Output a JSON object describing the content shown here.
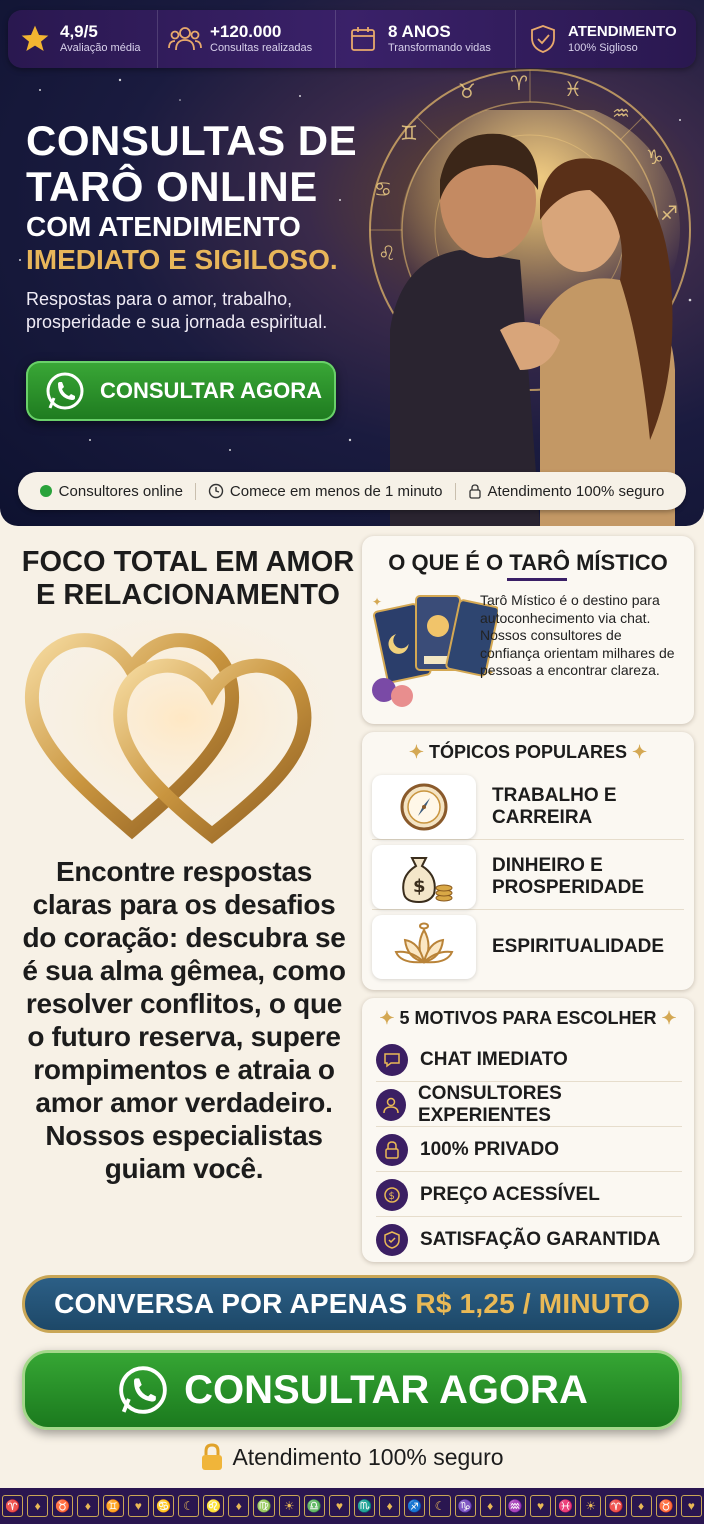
{
  "stats": [
    {
      "value": "4,9/5",
      "label": "Avaliação média",
      "icon": "star-icon"
    },
    {
      "value": "+120.000",
      "label": "Consultas realizadas",
      "icon": "people-icon"
    },
    {
      "value": "8 ANOS",
      "label": "Transformando vidas",
      "icon": "calendar-icon"
    },
    {
      "value": "ATENDIMENTO",
      "label": "100% Siglioso",
      "icon": "shield-icon"
    }
  ],
  "hero": {
    "title_line1": "CONSULTAS DE",
    "title_line2": "TARÔ ONLINE",
    "subtitle_line1": "COM ATENDIMENTO",
    "subtitle_line2": "IMEDIATO E SIGILOSO.",
    "description": "Respostas para o amor, trabalho, prosperidade e sua jornada espiritual.",
    "cta": "CONSULTAR AGORA"
  },
  "trust_pill": [
    {
      "label": "Consultores online",
      "icon": "online-dot-icon"
    },
    {
      "label": "Comece em menos de 1 minuto",
      "icon": "clock-icon"
    },
    {
      "label": "Atendimento 100% seguro",
      "icon": "lock-icon"
    }
  ],
  "love": {
    "title": "FOCO TOTAL EM AMOR E RELACIONAMENTO",
    "text": "Encontre respostas claras para os desafios do coração: descubra se é sua alma gêmea, como resolver conflitos, o que o futuro reserva, supere rompimentos e atraia o amor amor verdadeiro. Nossos especialistas guiam você."
  },
  "about": {
    "title": "O QUE É O TARÔ MÍSTICO",
    "text": "Tarô Místico é o destino para autoconhecimento via chat. Nossos consultores de confiança orientam milhares de pessoas a encontrar clareza."
  },
  "topics": {
    "title": "TÓPICOS POPULARES",
    "items": [
      {
        "label": "TRABALHO E CARREIRA",
        "icon": "compass-icon"
      },
      {
        "label": "DINHEIRO E PROSPERIDADE",
        "icon": "money-bag-icon"
      },
      {
        "label": "ESPIRITUALIDADE",
        "icon": "lotus-icon"
      }
    ]
  },
  "reasons": {
    "title": "5 MOTIVOS PARA ESCOLHER",
    "items": [
      {
        "label": "CHAT IMEDIATO",
        "icon": "chat-icon"
      },
      {
        "label": "CONSULTORES EXPERIENTES",
        "icon": "consultant-icon"
      },
      {
        "label": "100% PRIVADO",
        "icon": "lock-icon"
      },
      {
        "label": "PREÇO ACESSÍVEL",
        "icon": "coin-icon"
      },
      {
        "label": "SATISFAÇÃO GARANTIDA",
        "icon": "shield-check-icon"
      }
    ]
  },
  "price": {
    "prefix": "CONVERSA POR APENAS",
    "value": "R$ 1,25 / MINUTO"
  },
  "main_cta": "CONSULTAR AGORA",
  "secure_note": "Atendimento 100% seguro",
  "colors": {
    "purple": "#2a1850",
    "gold": "#e9b956",
    "green": "#2a9a2d",
    "blue": "#245577"
  }
}
